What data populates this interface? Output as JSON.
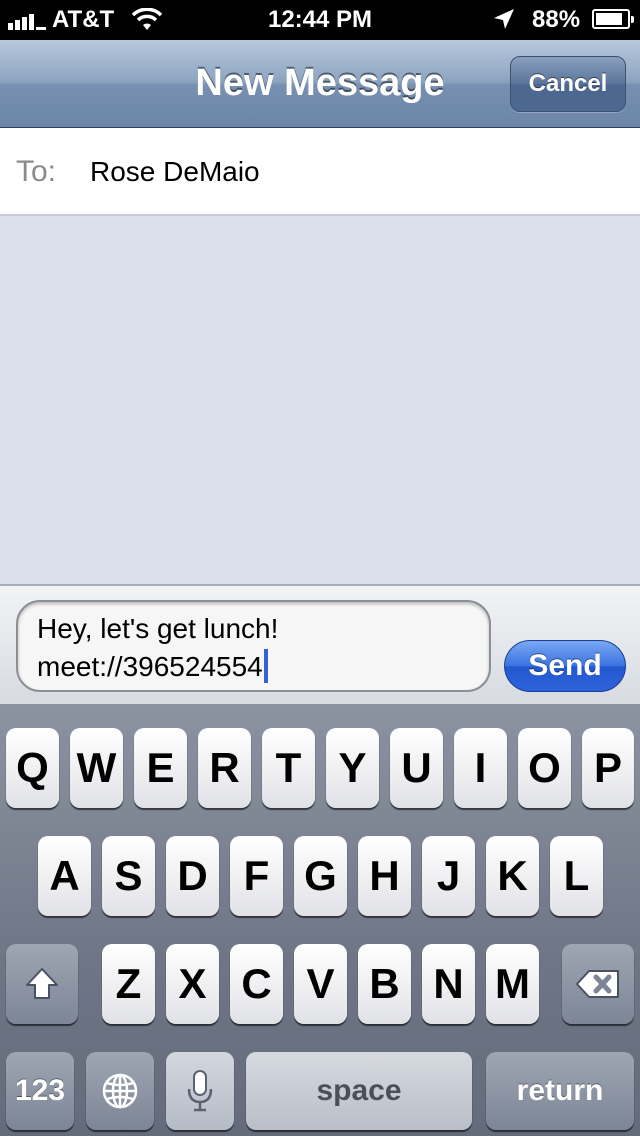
{
  "status_bar": {
    "carrier": "AT&T",
    "time": "12:44 PM",
    "battery": "88%",
    "battery_level": 0.88,
    "icons": [
      "signal-icon",
      "wifi-icon",
      "location-arrow-icon",
      "battery-icon"
    ]
  },
  "navbar": {
    "title": "New Message",
    "cancel_label": "Cancel"
  },
  "to_field": {
    "label": "To:",
    "recipient": "Rose DeMaio"
  },
  "compose": {
    "line1": "Hey, let's get lunch!",
    "line2": "meet://396524554",
    "send_label": "Send"
  },
  "keyboard": {
    "row1": [
      "Q",
      "W",
      "E",
      "R",
      "T",
      "Y",
      "U",
      "I",
      "O",
      "P"
    ],
    "row2": [
      "A",
      "S",
      "D",
      "F",
      "G",
      "H",
      "J",
      "K",
      "L"
    ],
    "row3": [
      "Z",
      "X",
      "C",
      "V",
      "B",
      "N",
      "M"
    ],
    "numbers_label": "123",
    "space_label": "space",
    "return_label": "return",
    "icons": [
      "shift-icon",
      "delete-icon",
      "globe-icon",
      "microphone-icon"
    ]
  },
  "colors": {
    "navbar": "#7790b1",
    "send_button": "#2d63da",
    "thread_background": "#dbe1ec",
    "caret": "#3460d8"
  }
}
